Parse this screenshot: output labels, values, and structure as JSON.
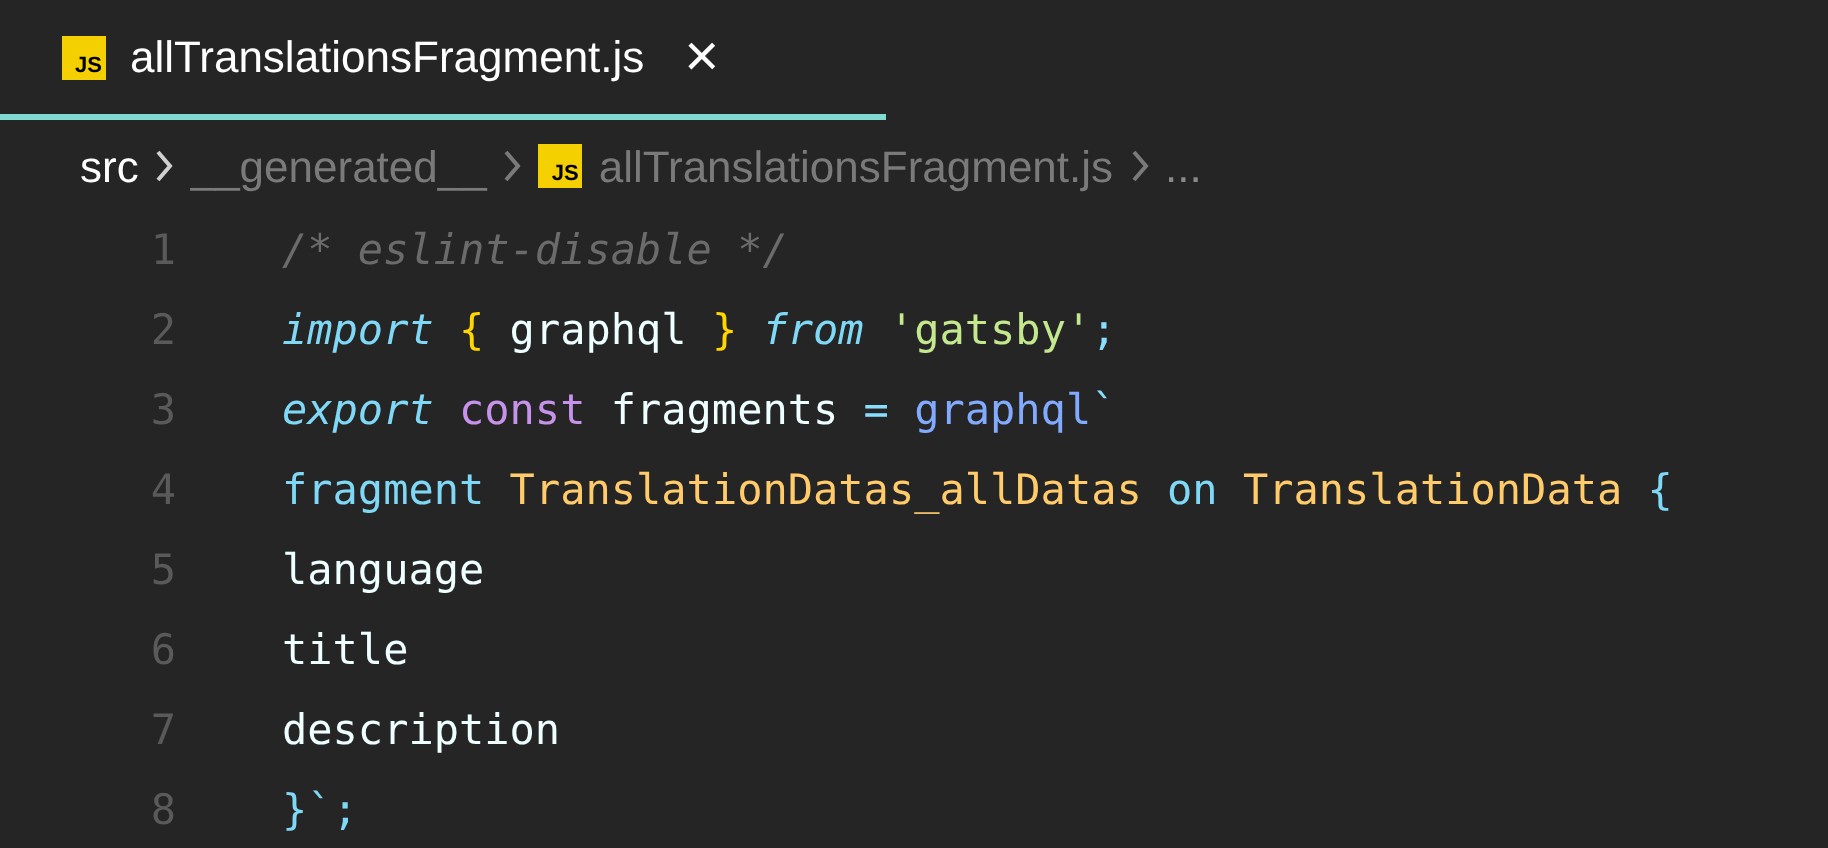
{
  "tab": {
    "icon_label": "JS",
    "title": "allTranslationsFragment.js",
    "close": "×",
    "selected": true
  },
  "breadcrumb": [
    {
      "kind": "folder",
      "label": "src",
      "current": true
    },
    {
      "kind": "folder",
      "label": "__generated__",
      "current": false
    },
    {
      "kind": "file",
      "icon_label": "JS",
      "label": "allTranslationsFragment.js",
      "current": false
    },
    {
      "kind": "more",
      "label": "..."
    }
  ],
  "code_lines": [
    {
      "number": "1",
      "tokens": [
        {
          "kind": "comment",
          "text": "/* eslint-disable */"
        }
      ]
    },
    {
      "number": "2",
      "tokens": [
        {
          "kind": "keyword_italic",
          "text": "import"
        },
        {
          "kind": "bracket",
          "text": " { "
        },
        {
          "kind": "plain",
          "text": "graphql"
        },
        {
          "kind": "bracket",
          "text": " } "
        },
        {
          "kind": "keyword_italic",
          "text": "from"
        },
        {
          "kind": "string",
          "text": " 'gatsby'"
        },
        {
          "kind": "operator",
          "text": ";"
        }
      ]
    },
    {
      "number": "3",
      "tokens": [
        {
          "kind": "keyword_italic",
          "text": "export"
        },
        {
          "kind": "storage",
          "text": " const"
        },
        {
          "kind": "plain",
          "text": " fragments"
        },
        {
          "kind": "operator",
          "text": " = "
        },
        {
          "kind": "function",
          "text": "graphql"
        },
        {
          "kind": "operator",
          "text": "`"
        }
      ]
    },
    {
      "number": "4",
      "tokens": [
        {
          "kind": "keyword",
          "text": "fragment"
        },
        {
          "kind": "type",
          "text": " TranslationDatas_allDatas"
        },
        {
          "kind": "keyword",
          "text": " on"
        },
        {
          "kind": "type",
          "text": " TranslationData"
        },
        {
          "kind": "keyword",
          "text": " {"
        }
      ]
    },
    {
      "number": "5",
      "tokens": [
        {
          "kind": "plain",
          "text": "language"
        }
      ]
    },
    {
      "number": "6",
      "tokens": [
        {
          "kind": "plain",
          "text": "title"
        }
      ]
    },
    {
      "number": "7",
      "tokens": [
        {
          "kind": "plain",
          "text": "description"
        }
      ]
    },
    {
      "number": "8",
      "tokens": [
        {
          "kind": "keyword",
          "text": "}`;"
        }
      ]
    }
  ]
}
